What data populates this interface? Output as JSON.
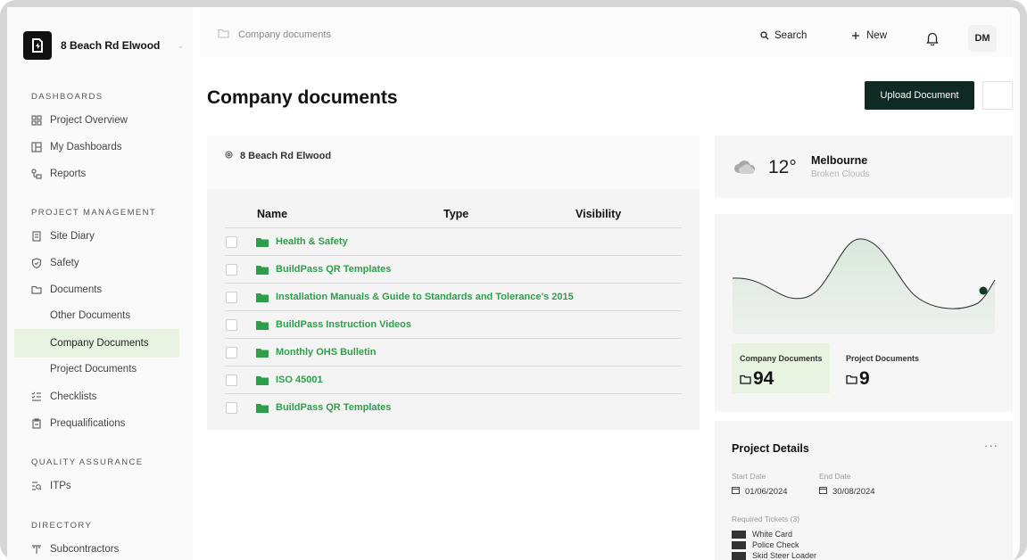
{
  "brand": {
    "name": "8 Beach Rd Elwood"
  },
  "sidebar": {
    "sections": [
      {
        "title": "DASHBOARDS"
      },
      {
        "title": "PROJECT MANAGEMENT"
      },
      {
        "title": "QUALITY ASSURANCE"
      },
      {
        "title": "DIRECTORY"
      }
    ],
    "items": [
      {
        "label": "Project Overview",
        "icon": "grid-icon"
      },
      {
        "label": "My Dashboards",
        "icon": "dashboard-icon"
      },
      {
        "label": "Reports",
        "icon": "reports-icon"
      },
      {
        "label": "Site Diary",
        "icon": "diary-icon"
      },
      {
        "label": "Safety",
        "icon": "shield-icon"
      },
      {
        "label": "Documents",
        "icon": "folder-icon"
      },
      {
        "label": "Checklists",
        "icon": "checklist-icon"
      },
      {
        "label": "Prequalifications",
        "icon": "clipboard-icon"
      },
      {
        "label": "ITPs",
        "icon": "itp-icon"
      },
      {
        "label": "Subcontractors",
        "icon": "subcontractor-icon"
      }
    ],
    "sub_items": [
      {
        "label": "Other Documents"
      },
      {
        "label": "Company Documents",
        "active": true
      },
      {
        "label": "Project Documents"
      }
    ]
  },
  "topbar": {
    "breadcrumb": "Company documents",
    "search_label": "Search",
    "new_label": "New",
    "avatar_initials": "DM"
  },
  "page": {
    "title": "Company documents",
    "upload_label": "Upload Document"
  },
  "documents": {
    "location": "8 Beach Rd Elwood",
    "columns": [
      "Name",
      "Type",
      "Visibility"
    ],
    "rows": [
      {
        "name": "Health & Safety"
      },
      {
        "name": "BuildPass QR Templates"
      },
      {
        "name": "Installation Manuals & Guide to Standards and Tolerance's 2015"
      },
      {
        "name": "BuildPass Instruction Videos"
      },
      {
        "name": "Monthly OHS Bulletin"
      },
      {
        "name": "ISO 45001"
      },
      {
        "name": "BuildPass QR Templates"
      }
    ]
  },
  "weather": {
    "temp": "12°",
    "city": "Melbourne",
    "condition": "Broken Clouds",
    "icon": "cloud-icon"
  },
  "stats": {
    "company_label": "Company Documents",
    "company_count": "94",
    "project_label": "Project Documents",
    "project_count": "9"
  },
  "project_details": {
    "title": "Project Details",
    "more": "···",
    "start_label": "Start Date",
    "start_date": "01/06/2024",
    "end_label": "End Date",
    "end_date": "30/08/2024",
    "tickets_label": "Required Tickets (3)",
    "tickets": [
      "White Card",
      "Police Check",
      "Skid Steer Loader"
    ]
  },
  "colors": {
    "accent_green": "#2f9e4a",
    "active_bg": "#e8f4e1",
    "button_dark": "#0f2a22"
  }
}
